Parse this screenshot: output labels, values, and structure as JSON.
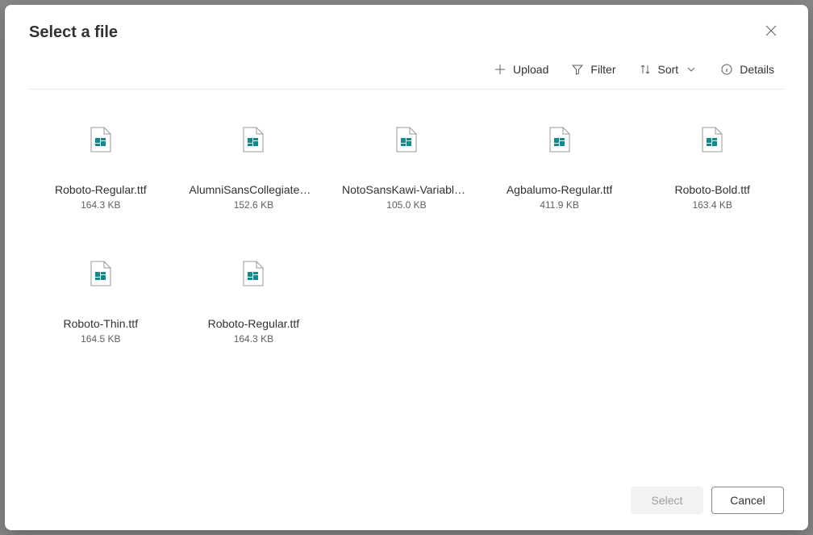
{
  "dialog": {
    "title": "Select a file"
  },
  "toolbar": {
    "upload": "Upload",
    "filter": "Filter",
    "sort": "Sort",
    "details": "Details"
  },
  "files": [
    {
      "name": "Roboto-Regular.ttf",
      "size": "164.3 KB"
    },
    {
      "name": "AlumniSansCollegiateOne-Regular.ttf",
      "size": "152.6 KB"
    },
    {
      "name": "NotoSansKawi-VariableFont_wght.ttf",
      "size": "105.0 KB"
    },
    {
      "name": "Agbalumo-Regular.ttf",
      "size": "411.9 KB"
    },
    {
      "name": "Roboto-Bold.ttf",
      "size": "163.4 KB"
    },
    {
      "name": "Roboto-Thin.ttf",
      "size": "164.5 KB"
    },
    {
      "name": "Roboto-Regular.ttf",
      "size": "164.3 KB"
    }
  ],
  "footer": {
    "select": "Select",
    "cancel": "Cancel"
  }
}
